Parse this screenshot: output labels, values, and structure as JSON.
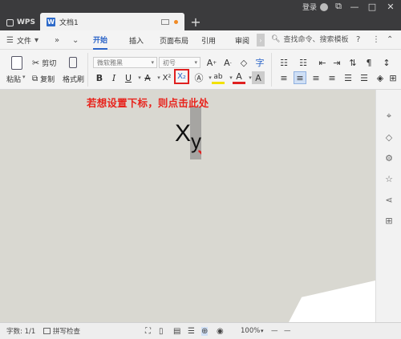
{
  "titlebar": {
    "app_name": "WPS",
    "doc_tab_title": "文档1",
    "doc_icon_letter": "W",
    "new_tab": "+",
    "login_label": "登录",
    "minimize": "—",
    "maximize": "□",
    "close": "✕"
  },
  "ribbon": {
    "file_menu": "文件",
    "tabs": [
      "开始",
      "插入",
      "页面布局",
      "引用",
      "审阅"
    ],
    "active_tab": "开始",
    "search_placeholder": "查找命令、搜索模板",
    "more": "»"
  },
  "toolbar": {
    "paste": "粘贴",
    "cut": "剪切",
    "copy": "复制",
    "format_painter": "格式刷",
    "font_name": "微软雅黑",
    "font_size": "初号",
    "bold": "B",
    "italic": "I",
    "underline": "U",
    "strikethrough": "A",
    "superscript": "X²",
    "subscript": "X₂",
    "font_color": "A",
    "highlight": "ab",
    "char_shading": "A"
  },
  "annotation": "若想设置下标，则点击此处",
  "document": {
    "main_char": "X",
    "sub_char": "y"
  },
  "statusbar": {
    "word_count": "字数: 1/1",
    "spell_check": "拼写检查",
    "zoom": "100%",
    "zoom_out": "—",
    "zoom_in": "—"
  },
  "colors": {
    "accent": "#2b64c8",
    "annotation_red": "#e8231c",
    "titlebar": "#3b3b3d",
    "page_bg": "#d9d8d1"
  }
}
